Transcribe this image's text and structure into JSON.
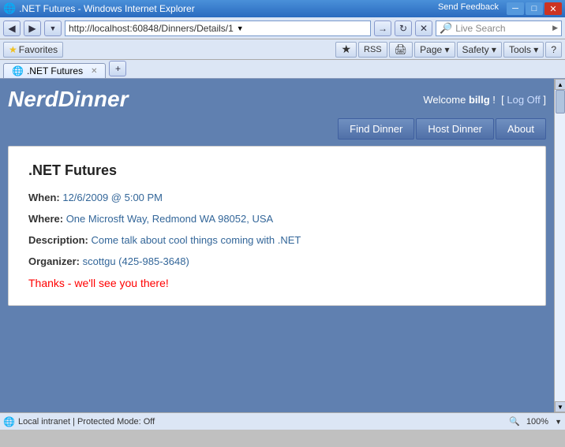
{
  "titlebar": {
    "title": ".NET Futures - Windows Internet Explorer",
    "send_feedback": "Send Feedback",
    "min": "─",
    "max": "□",
    "close": "✕"
  },
  "addressbar": {
    "back_icon": "◀",
    "forward_icon": "▶",
    "refresh_icon": "↻",
    "stop_icon": "✕",
    "url": "http://localhost:60848/Dinners/Details/1",
    "ie_icon": "e",
    "search_placeholder": "Live Search",
    "search_icon": "🔍"
  },
  "toolbar": {
    "favorites_label": "Favorites",
    "tools": [
      "Page ▾",
      "Safety ▾",
      "Tools ▾",
      "?"
    ]
  },
  "tabs": [
    {
      "label": ".NET Futures",
      "icon": "e",
      "active": true
    }
  ],
  "app": {
    "title": "NerdDinner",
    "welcome": "Welcome",
    "username": "billg",
    "welcome_suffix": "!",
    "log_off_label": "Log Off",
    "nav": [
      {
        "label": "Find Dinner"
      },
      {
        "label": "Host Dinner"
      },
      {
        "label": "About"
      }
    ],
    "dinner": {
      "title": ".NET Futures",
      "when_label": "When:",
      "when_value": "12/6/2009 @ 5:00 PM",
      "where_label": "Where:",
      "where_value": "One Microsft Way, Redmond WA 98052, USA",
      "description_label": "Description:",
      "description_value": "Come talk about cool things coming with .NET",
      "organizer_label": "Organizer:",
      "organizer_value": "scottgu (425-985-3648)",
      "thanks_msg": "Thanks - we'll see you there!"
    }
  },
  "statusbar": {
    "zone": "Local intranet | Protected Mode: Off",
    "zoom": "100%"
  }
}
